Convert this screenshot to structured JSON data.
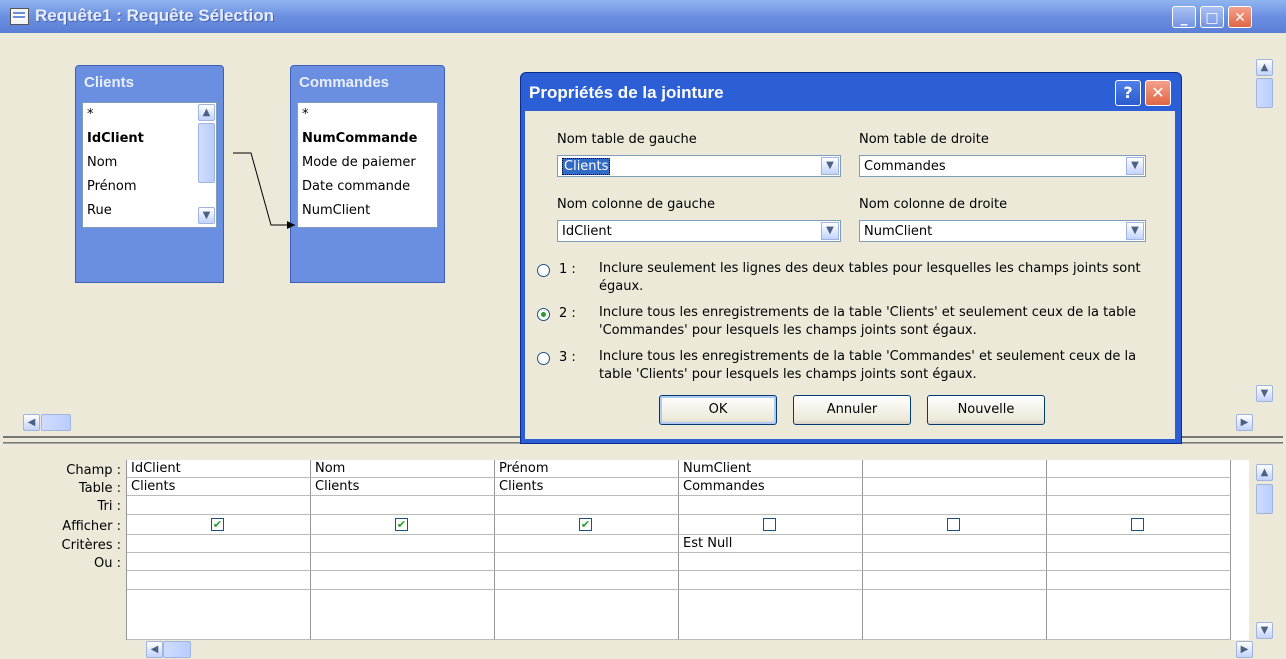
{
  "window": {
    "title": "Requête1 : Requête Sélection",
    "minimize": "_",
    "maximize": "□",
    "close": "✕"
  },
  "tables": [
    {
      "name": "Clients",
      "fields": [
        "*",
        "IdClient",
        "Nom",
        "Prénom",
        "Rue"
      ],
      "key_field": "IdClient"
    },
    {
      "name": "Commandes",
      "fields": [
        "*",
        "NumCommande",
        "Mode de paiemer",
        "Date commande",
        "NumClient"
      ],
      "key_field": "NumCommande"
    }
  ],
  "dialog": {
    "title": "Propriétés de la jointure",
    "help": "?",
    "close": "✕",
    "left_table_label": "Nom table de gauche",
    "left_table_value": "Clients",
    "right_table_label": "Nom table de droite",
    "right_table_value": "Commandes",
    "left_column_label": "Nom colonne de gauche",
    "left_column_value": "IdClient",
    "right_column_label": "Nom colonne de droite",
    "right_column_value": "NumClient",
    "options": [
      {
        "num": "1 :",
        "text": "Inclure seulement les lignes des deux tables pour lesquelles les champs joints sont égaux.",
        "selected": false
      },
      {
        "num": "2 :",
        "text": "Inclure tous les enregistrements de la table 'Clients' et seulement ceux de la table  'Commandes' pour lesquels les champs joints sont égaux.",
        "selected": true
      },
      {
        "num": "3 :",
        "text": "Inclure tous les enregistrements de la table 'Commandes' et seulement ceux de la table  'Clients' pour lesquels les champs joints sont égaux.",
        "selected": false
      }
    ],
    "ok": "OK",
    "cancel": "Annuler",
    "new": "Nouvelle"
  },
  "grid": {
    "row_labels": [
      "Champ :",
      "Table :",
      "Tri :",
      "Afficher :",
      "Critères :",
      "Ou :"
    ],
    "columns": [
      {
        "champ": "IdClient",
        "table": "Clients",
        "afficher": true,
        "criteres": ""
      },
      {
        "champ": "Nom",
        "table": "Clients",
        "afficher": true,
        "criteres": ""
      },
      {
        "champ": "Prénom",
        "table": "Clients",
        "afficher": true,
        "criteres": ""
      },
      {
        "champ": "NumClient",
        "table": "Commandes",
        "afficher": false,
        "criteres": "Est Null"
      },
      {
        "champ": "",
        "table": "",
        "afficher": false,
        "criteres": ""
      },
      {
        "champ": "",
        "table": "",
        "afficher": false,
        "criteres": ""
      }
    ]
  },
  "colors": {
    "title_blue": "#6b8fe0",
    "dialog_blue": "#2c5fd6",
    "face": "#ece9d8",
    "close_red": "#e06744"
  },
  "icons": [
    "query-window-icon",
    "minimize-icon",
    "maximize-icon",
    "close-icon",
    "help-icon",
    "dropdown-arrow-icon",
    "scroll-up-icon",
    "scroll-down-icon",
    "scroll-left-icon",
    "scroll-right-icon",
    "checkmark-icon"
  ]
}
